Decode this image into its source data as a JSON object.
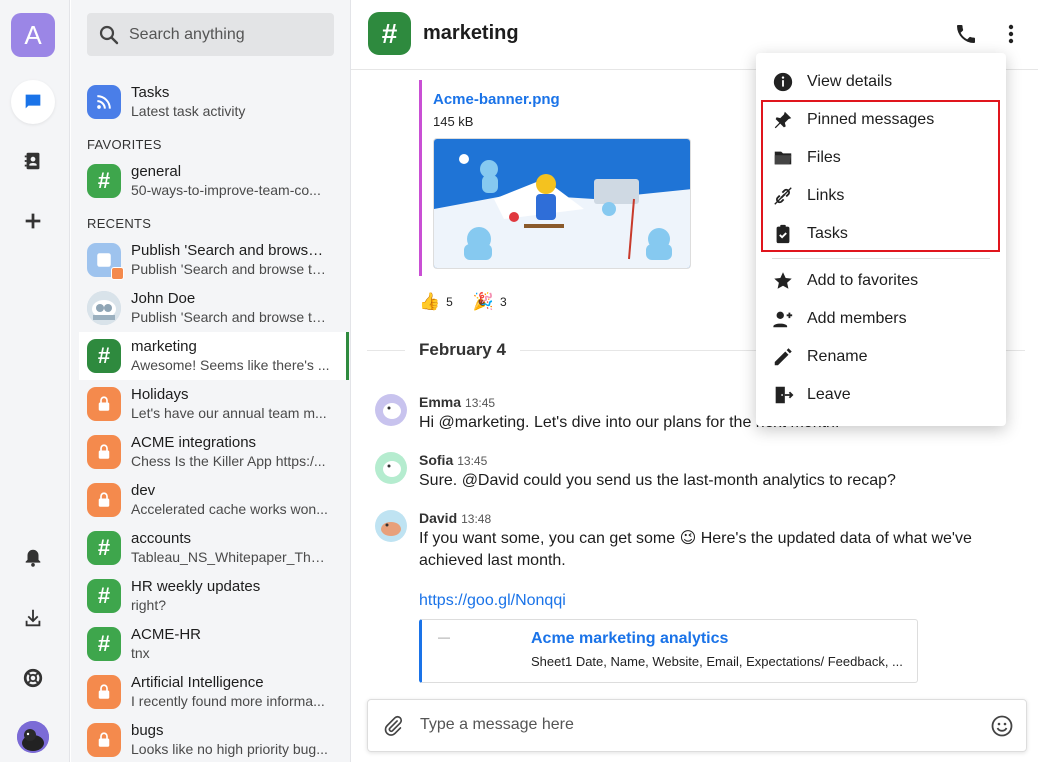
{
  "rail": {
    "app_initial": "A",
    "icons": [
      "chat-icon",
      "contacts-icon",
      "add-icon",
      "notification-bell-icon",
      "download-icon",
      "help-lifebuoy-icon"
    ]
  },
  "search": {
    "placeholder": "Search anything"
  },
  "sections": {
    "favorites": "FAVORITES",
    "recents": "RECENTS"
  },
  "tasks_item": {
    "title": "Tasks",
    "subtitle": "Latest task activity"
  },
  "favorites": [
    {
      "title": "general",
      "subtitle": "50-ways-to-improve-team-co..."
    }
  ],
  "recents": [
    {
      "title": "Publish 'Search and browse ...",
      "subtitle": "Publish 'Search and browse ta..."
    },
    {
      "title": "John Doe",
      "subtitle": "Publish 'Search and browse ta..."
    },
    {
      "title": "marketing",
      "subtitle": "Awesome! Seems like there's ..."
    },
    {
      "title": "Holidays",
      "subtitle": "Let's have our annual team m..."
    },
    {
      "title": "ACME integrations",
      "subtitle": "Chess Is the Killer App https:/..."
    },
    {
      "title": "dev",
      "subtitle": "Accelerated cache works won..."
    },
    {
      "title": "accounts",
      "subtitle": "Tableau_NS_Whitepaper_The_..."
    },
    {
      "title": "HR weekly updates",
      "subtitle": "right?"
    },
    {
      "title": "ACME-HR",
      "subtitle": "tnx"
    },
    {
      "title": "Artificial Intelligence",
      "subtitle": "I recently found more informa..."
    },
    {
      "title": "bugs",
      "subtitle": "Looks like no high priority bug..."
    }
  ],
  "header": {
    "icon": "#",
    "title": "marketing"
  },
  "attachment": {
    "name": "Acme-banner.png",
    "size": "145 kB"
  },
  "reactions": [
    {
      "emoji": "👍",
      "count": "5"
    },
    {
      "emoji": "🎉",
      "count": "3"
    }
  ],
  "date_separator": "February 4",
  "messages": [
    {
      "author": "Emma",
      "time": "13:45",
      "text": "Hi @marketing. Let's dive into our plans for the next month!"
    },
    {
      "author": "Sofia",
      "time": "13:45",
      "text": "Sure. @David could you send us the last-month analytics to recap?"
    },
    {
      "author": "David",
      "time": "13:48",
      "text": "If you want some, you can get some 😉 Here's the updated data of what we've achieved last month."
    }
  ],
  "link": "https://goo.gl/Nonqqi",
  "link_preview": {
    "dash": "—",
    "title": "Acme marketing analytics",
    "description": "Sheet1 Date, Name, Website, Email, Expectations/ Feedback, ..."
  },
  "composer": {
    "placeholder": "Type a message here"
  },
  "menu": {
    "items": [
      {
        "label": "View details",
        "icon": "info-icon"
      },
      {
        "label": "Pinned messages",
        "icon": "pin-icon"
      },
      {
        "label": "Files",
        "icon": "folder-icon"
      },
      {
        "label": "Links",
        "icon": "link-icon"
      },
      {
        "label": "Tasks",
        "icon": "clipboard-check-icon"
      },
      {
        "label": "Add to favorites",
        "icon": "star-icon"
      },
      {
        "label": "Add members",
        "icon": "add-person-icon"
      },
      {
        "label": "Rename",
        "icon": "pencil-icon"
      },
      {
        "label": "Leave",
        "icon": "leave-icon"
      }
    ]
  },
  "colors": {
    "accent_green": "#2e8a3e",
    "link_blue": "#1a73e8",
    "lock_orange": "#f48a4d",
    "highlight_red": "#e0151d"
  }
}
